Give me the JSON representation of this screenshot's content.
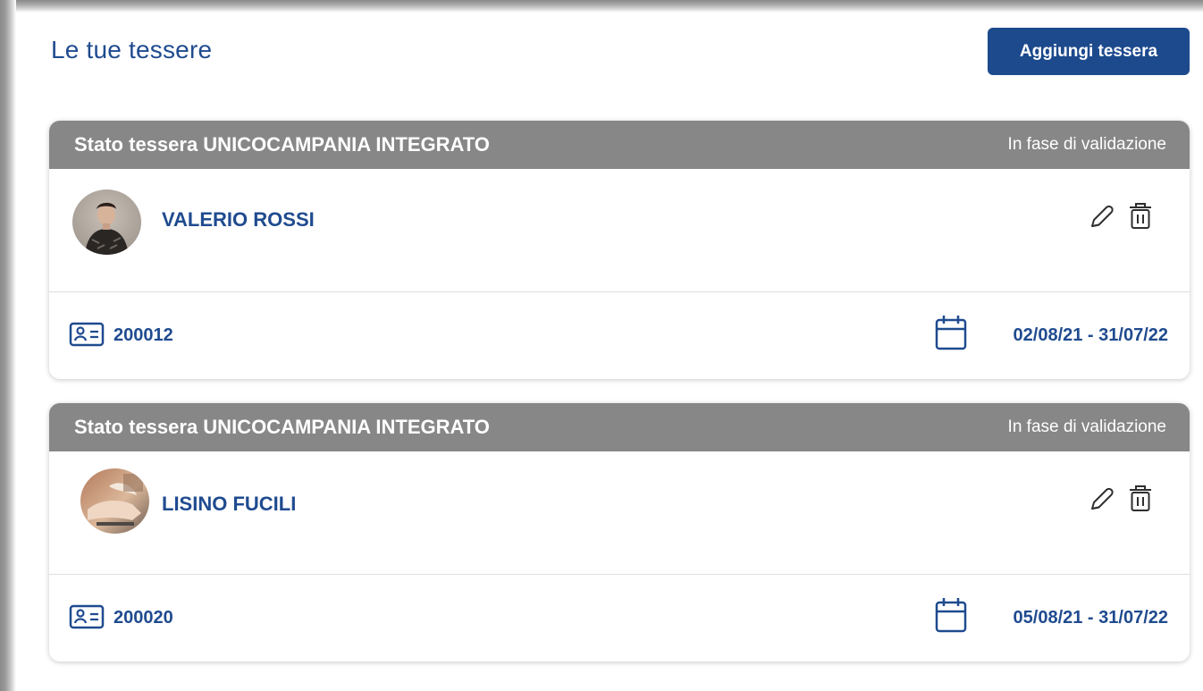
{
  "page": {
    "title": "Le tue tessere",
    "add_button_label": "Aggiungi tessera"
  },
  "colors": {
    "primary": "#1f4b8f",
    "button": "#1d4a8d",
    "card_header": "#878787"
  },
  "cards": [
    {
      "title": "Stato tessera UNICOCAMPANIA INTEGRATO",
      "status": "In fase di validazione",
      "holder_name": "VALERIO ROSSI",
      "avatar": "person-photo",
      "card_number": "200012",
      "validity": "02/08/21 - 31/07/22",
      "icons": {
        "edit": "pencil-icon",
        "delete": "trash-icon",
        "card": "id-card-icon",
        "calendar": "calendar-icon"
      }
    },
    {
      "title": "Stato tessera UNICOCAMPANIA INTEGRATO",
      "status": "In fase di validazione",
      "holder_name": "LISINO FUCILI",
      "avatar": "hands-photo",
      "card_number": "200020",
      "validity": "05/08/21 - 31/07/22",
      "icons": {
        "edit": "pencil-icon",
        "delete": "trash-icon",
        "card": "id-card-icon",
        "calendar": "calendar-icon"
      }
    }
  ]
}
